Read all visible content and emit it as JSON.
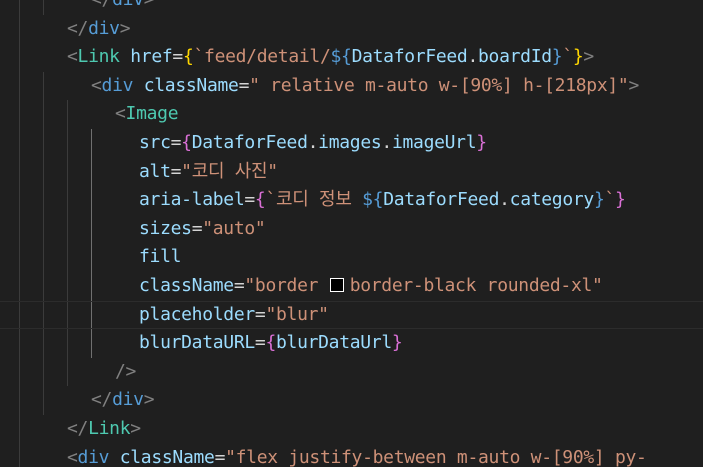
{
  "editor": {
    "lines": [
      {
        "indent": 2,
        "tokens": [
          [
            "punc",
            "</"
          ],
          [
            "html",
            "div"
          ],
          [
            "punc",
            ">"
          ]
        ]
      },
      {
        "indent": 1,
        "tokens": [
          [
            "punc",
            "</"
          ],
          [
            "html",
            "div"
          ],
          [
            "punc",
            ">"
          ]
        ]
      },
      {
        "indent": 1,
        "tokens": [
          [
            "punc",
            "<"
          ],
          [
            "tag",
            "Link"
          ],
          [
            "text",
            " "
          ],
          [
            "attr",
            "href"
          ],
          [
            "eq",
            "="
          ],
          [
            "b1",
            "{"
          ],
          [
            "str",
            "`feed/detail/"
          ],
          [
            "tpl",
            "${"
          ],
          [
            "var",
            "DataforFeed"
          ],
          [
            "eq",
            "."
          ],
          [
            "var",
            "boardId"
          ],
          [
            "tpl",
            "}"
          ],
          [
            "str",
            "`"
          ],
          [
            "b1",
            "}"
          ],
          [
            "punc",
            ">"
          ]
        ]
      },
      {
        "indent": 2,
        "tokens": [
          [
            "punc",
            "<"
          ],
          [
            "html",
            "div"
          ],
          [
            "text",
            " "
          ],
          [
            "attr",
            "className"
          ],
          [
            "eq",
            "="
          ],
          [
            "str",
            "\" relative m-auto w-[90%] h-[218px]\""
          ],
          [
            "punc",
            ">"
          ]
        ]
      },
      {
        "indent": 3,
        "tokens": [
          [
            "punc",
            "<"
          ],
          [
            "tag",
            "Image"
          ]
        ]
      },
      {
        "indent": 4,
        "tokens": [
          [
            "attr",
            "src"
          ],
          [
            "eq",
            "="
          ],
          [
            "b2",
            "{"
          ],
          [
            "var",
            "DataforFeed"
          ],
          [
            "eq",
            "."
          ],
          [
            "var",
            "images"
          ],
          [
            "eq",
            "."
          ],
          [
            "var",
            "imageUrl"
          ],
          [
            "b2",
            "}"
          ]
        ]
      },
      {
        "indent": 4,
        "tokens": [
          [
            "attr",
            "alt"
          ],
          [
            "eq",
            "="
          ],
          [
            "str",
            "\"코디 사진\""
          ]
        ]
      },
      {
        "indent": 4,
        "tokens": [
          [
            "attr",
            "aria-label"
          ],
          [
            "eq",
            "="
          ],
          [
            "b2",
            "{"
          ],
          [
            "str",
            "`코디 정보 "
          ],
          [
            "tpl",
            "${"
          ],
          [
            "var",
            "DataforFeed"
          ],
          [
            "eq",
            "."
          ],
          [
            "var",
            "category"
          ],
          [
            "tpl",
            "}"
          ],
          [
            "str",
            "`"
          ],
          [
            "b2",
            "}"
          ]
        ]
      },
      {
        "indent": 4,
        "tokens": [
          [
            "attr",
            "sizes"
          ],
          [
            "eq",
            "="
          ],
          [
            "str",
            "\"auto\""
          ]
        ]
      },
      {
        "indent": 4,
        "tokens": [
          [
            "attr",
            "fill"
          ]
        ]
      },
      {
        "indent": 4,
        "tokens": [
          [
            "attr",
            "className"
          ],
          [
            "eq",
            "="
          ],
          [
            "str",
            "\"border "
          ],
          [
            "swatch",
            "#000000"
          ],
          [
            "str",
            "border-black rounded-xl\""
          ]
        ]
      },
      {
        "indent": 4,
        "highlight": true,
        "tokens": [
          [
            "attr",
            "placeholder"
          ],
          [
            "eq",
            "="
          ],
          [
            "str",
            "\"blur\""
          ]
        ]
      },
      {
        "indent": 4,
        "tokens": [
          [
            "attr",
            "blurDataURL"
          ],
          [
            "eq",
            "="
          ],
          [
            "b2",
            "{"
          ],
          [
            "var",
            "blurDataUrl"
          ],
          [
            "b2",
            "}"
          ]
        ]
      },
      {
        "indent": 3,
        "tokens": [
          [
            "punc",
            "/>"
          ]
        ]
      },
      {
        "indent": 2,
        "tokens": [
          [
            "punc",
            "</"
          ],
          [
            "html",
            "div"
          ],
          [
            "punc",
            ">"
          ]
        ]
      },
      {
        "indent": 1,
        "tokens": [
          [
            "punc",
            "</"
          ],
          [
            "tag",
            "Link"
          ],
          [
            "punc",
            ">"
          ]
        ]
      },
      {
        "indent": 1,
        "tokens": [
          [
            "punc",
            "<"
          ],
          [
            "html",
            "div"
          ],
          [
            "text",
            " "
          ],
          [
            "attr",
            "className"
          ],
          [
            "eq",
            "="
          ],
          [
            "str",
            "\"flex justify-between m-auto w-[90%] py-"
          ]
        ]
      }
    ]
  },
  "colors": {
    "background": "#1f1f1f",
    "punctuation": "#808080",
    "component_tag": "#4ec9b0",
    "html_tag": "#569cd6",
    "attribute": "#9cdcfe",
    "string": "#ce9178",
    "bracket_level_1": "#ffd700",
    "bracket_level_2": "#da70d6",
    "template_delimiter": "#569cd6",
    "color_swatch": "#000000"
  }
}
